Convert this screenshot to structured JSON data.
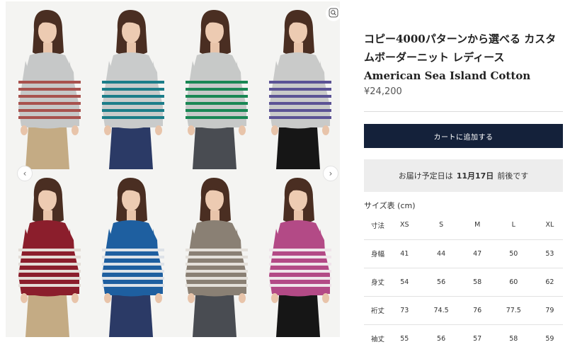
{
  "gallery": {
    "photos": [
      {
        "sweater": "#c6c8c8",
        "stripe": "#a8524e",
        "pants": "#c4ab84"
      },
      {
        "sweater": "#c9cbcb",
        "stripe": "#1b7d89",
        "pants": "#2b3a66"
      },
      {
        "sweater": "#c7c9c8",
        "stripe": "#198754",
        "pants": "#494c52"
      },
      {
        "sweater": "#c9cac9",
        "stripe": "#5b5295",
        "pants": "#161616"
      },
      {
        "sweater": "#8b1e2c",
        "stripe": "#e3dcd6",
        "pants": "#c4ab84"
      },
      {
        "sweater": "#1e5fa0",
        "stripe": "#dde2e8",
        "pants": "#2b3a66"
      },
      {
        "sweater": "#8a8074",
        "stripe": "#e4e0da",
        "pants": "#494c52"
      },
      {
        "sweater": "#b34a86",
        "stripe": "#efe5ea",
        "pants": "#161616"
      }
    ],
    "icons": {
      "zoom": "zoom-in-icon",
      "prev": "chevron-left-icon",
      "next": "chevron-right-icon"
    },
    "prev_glyph": "‹",
    "next_glyph": "›"
  },
  "product": {
    "title": "コピー4000パターンから選べる カスタムボーダーニット レディース American Sea Island Cotton",
    "price": "¥24,200",
    "add_to_cart": "カートに追加する",
    "delivery": {
      "prefix": "お届け予定日は",
      "date": "11月17日",
      "suffix": "前後です"
    }
  },
  "size_chart": {
    "title": "サイズ表 (cm)",
    "headers": [
      "寸法",
      "XS",
      "S",
      "M",
      "L",
      "XL"
    ],
    "rows": [
      [
        "身幅",
        "41",
        "44",
        "47",
        "50",
        "53"
      ],
      [
        "身丈",
        "54",
        "56",
        "58",
        "60",
        "62"
      ],
      [
        "裄丈",
        "73",
        "74.5",
        "76",
        "77.5",
        "79"
      ],
      [
        "袖丈",
        "55",
        "56",
        "57",
        "58",
        "59"
      ]
    ]
  },
  "colors": {
    "accent": "#14213a",
    "delivery_bg": "#ededed"
  }
}
